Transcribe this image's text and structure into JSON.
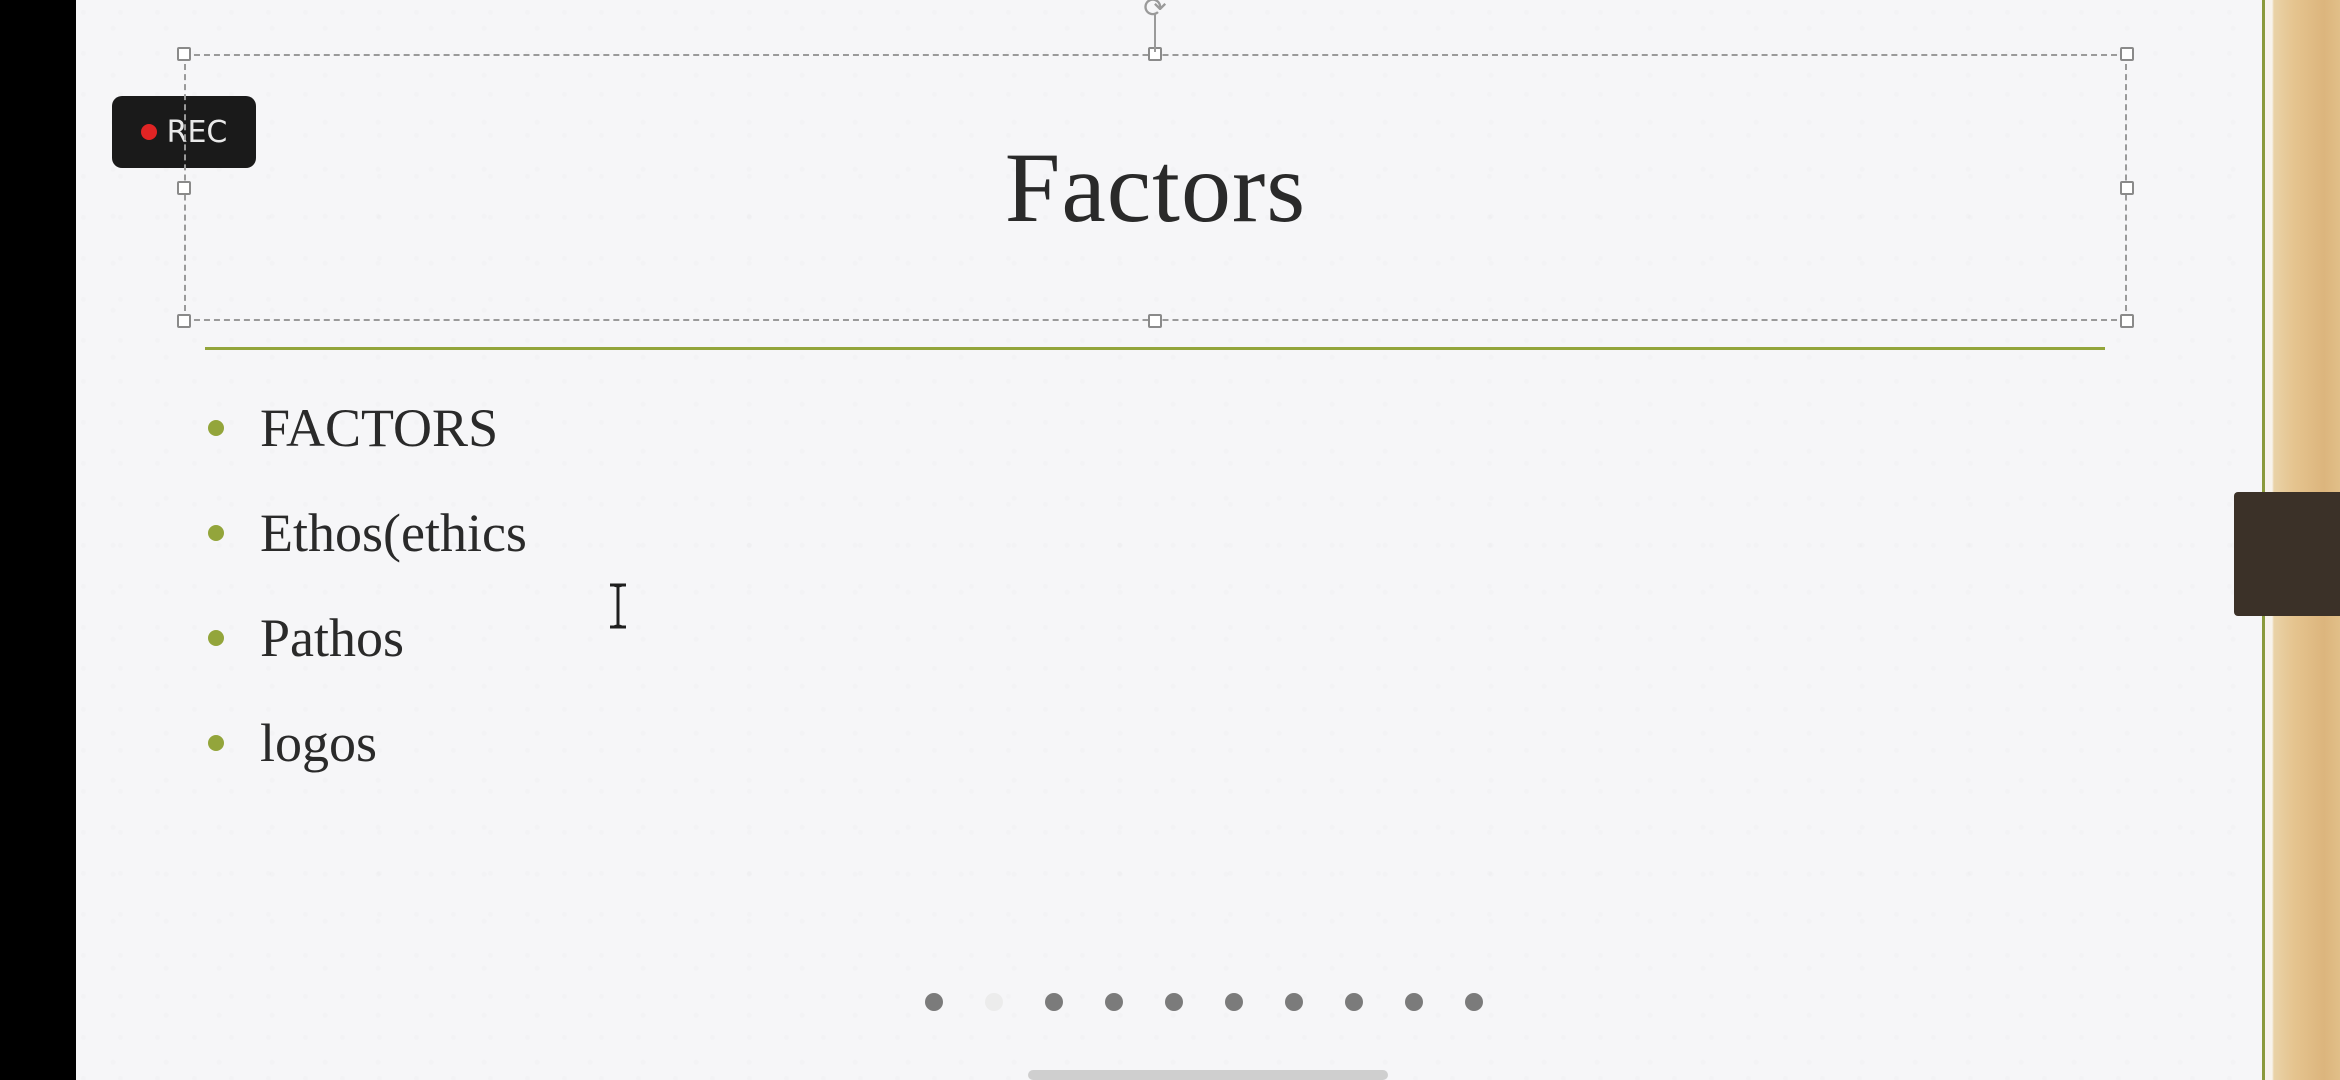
{
  "recording": {
    "label": "REC",
    "dot_color": "#e02424"
  },
  "slide": {
    "title": "Factors",
    "accent_color": "#93a53b",
    "bullets": [
      "FACTORS",
      "Ethos(ethics",
      "Pathos",
      "logos"
    ]
  },
  "pagination": {
    "total": 10,
    "active_index": 1
  },
  "icons": {
    "rotate": "rotate-icon",
    "text_cursor": "ibeam-cursor-icon"
  }
}
